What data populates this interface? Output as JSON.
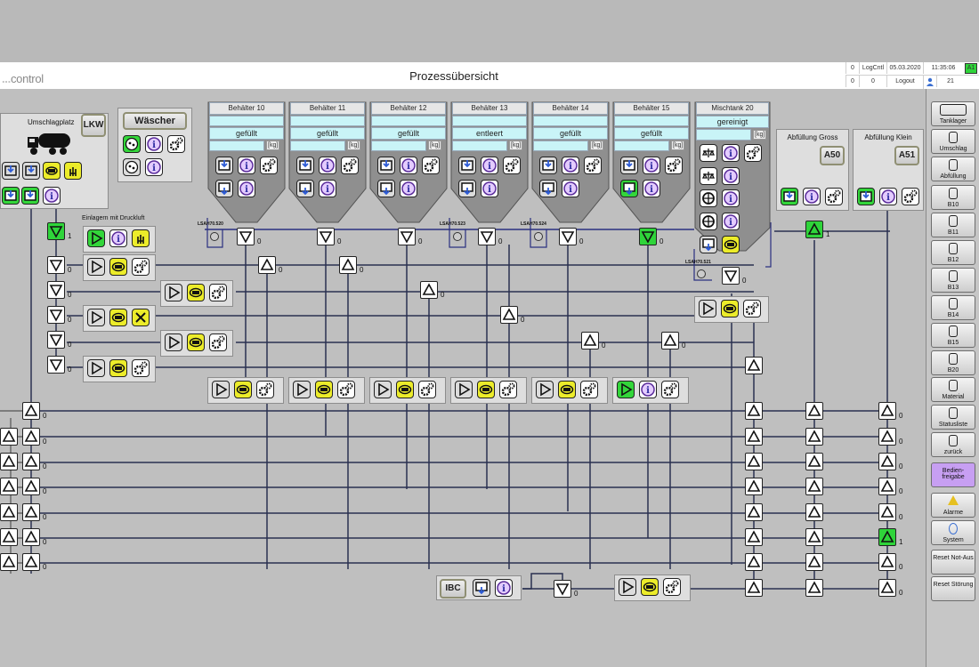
{
  "header": {
    "logo_part1": "...",
    "logo_part2": "control",
    "title": "Prozessübersicht",
    "row1": {
      "c1": "0",
      "c2": "LogCntl",
      "c3": "05.03.2020",
      "c4": "11:35:06",
      "c5": "A1"
    },
    "row2": {
      "c1": "0",
      "c2": "0",
      "c3": "Logout",
      "c4": "21"
    }
  },
  "nav": [
    {
      "label": "Tanklager"
    },
    {
      "label": "Umschlag"
    },
    {
      "label": "Abfüllung"
    },
    {
      "label": "B10"
    },
    {
      "label": "B11"
    },
    {
      "label": "B12"
    },
    {
      "label": "B13"
    },
    {
      "label": "B14"
    },
    {
      "label": "B15"
    },
    {
      "label": "B20"
    },
    {
      "label": "Material"
    },
    {
      "label": "Statusliste"
    },
    {
      "label": "zurück"
    },
    {
      "label": "Bedien-freigabe"
    },
    {
      "label": "Alarme"
    },
    {
      "label": "System"
    },
    {
      "label": "Reset Not-Aus"
    },
    {
      "label": "Reset Störung"
    }
  ],
  "umschlag": {
    "title": "Umschlagplatz",
    "code": "LKW"
  },
  "waescher": {
    "title": "Wäscher"
  },
  "druckluft": {
    "title": "Einlagern mit Druckluft"
  },
  "tanks": [
    {
      "title": "Behälter 10",
      "status": "gefüllt",
      "unit": "[kg]"
    },
    {
      "title": "Behälter 11",
      "status": "gefüllt",
      "unit": "[kg]"
    },
    {
      "title": "Behälter 12",
      "status": "gefüllt",
      "unit": "[kg]"
    },
    {
      "title": "Behälter 13",
      "status": "entleert",
      "unit": "[kg]"
    },
    {
      "title": "Behälter 14",
      "status": "gefüllt",
      "unit": "[kg]"
    },
    {
      "title": "Behälter 15",
      "status": "gefüllt",
      "unit": "[kg]"
    }
  ],
  "mischtank": {
    "title": "Mischtank 20",
    "status": "gereinigt",
    "unit": "[kg]"
  },
  "abf_gross": {
    "title": "Abfüllung Gross",
    "code": "A50"
  },
  "abf_klein": {
    "title": "Abfüllung Klein",
    "code": "A51"
  },
  "ibc": {
    "code": "IBC"
  },
  "sensor_tags": {
    "t1": "LSAH70.520",
    "t2": "LSAH70.523",
    "t3": "LSAH70.524",
    "t4": "LSAH70.521"
  },
  "valve_values": {
    "zero": "0",
    "one": "1"
  },
  "colors": {
    "active": "#2fd43a",
    "warning": "#ecec2a",
    "cyan": "#c9f4f7",
    "pipe": "#2a3050",
    "accent_purple": "#c79ff2"
  }
}
